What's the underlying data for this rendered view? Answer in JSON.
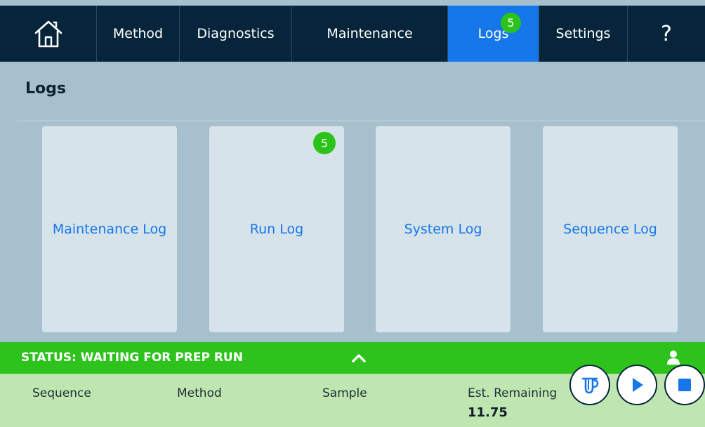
{
  "nav": {
    "home_icon": "home-icon",
    "items": [
      {
        "label": "Method"
      },
      {
        "label": "Diagnostics"
      },
      {
        "label": "Maintenance"
      },
      {
        "label": "Logs",
        "badge": "5",
        "active": true
      },
      {
        "label": "Settings"
      },
      {
        "label": "?"
      }
    ]
  },
  "page": {
    "title": "Logs"
  },
  "tiles": [
    {
      "label": "Maintenance Log"
    },
    {
      "label": "Run Log",
      "badge": "5"
    },
    {
      "label": "System Log"
    },
    {
      "label": "Sequence Log"
    }
  ],
  "status": {
    "text": "STATUS: WAITING FOR PREP RUN",
    "chevron_icon": "chevron-up-icon",
    "user_icon": "user-icon"
  },
  "info": {
    "sequence_label": "Sequence",
    "method_label": "Method",
    "sample_label": "Sample",
    "est_remaining_label": "Est. Remaining",
    "est_remaining_value": "11.75"
  },
  "controls": {
    "prep_icon": "sample-tube-icon",
    "play_icon": "play-icon",
    "stop_icon": "stop-icon"
  },
  "colors": {
    "nav_bg": "#06253a",
    "accent_blue": "#1577ea",
    "badge_green": "#2bc31a",
    "status_green": "#2dc31c",
    "info_panel_green": "#bfe6b0",
    "page_bg": "#a6c1cd",
    "tile_bg": "#d6e3ea"
  }
}
